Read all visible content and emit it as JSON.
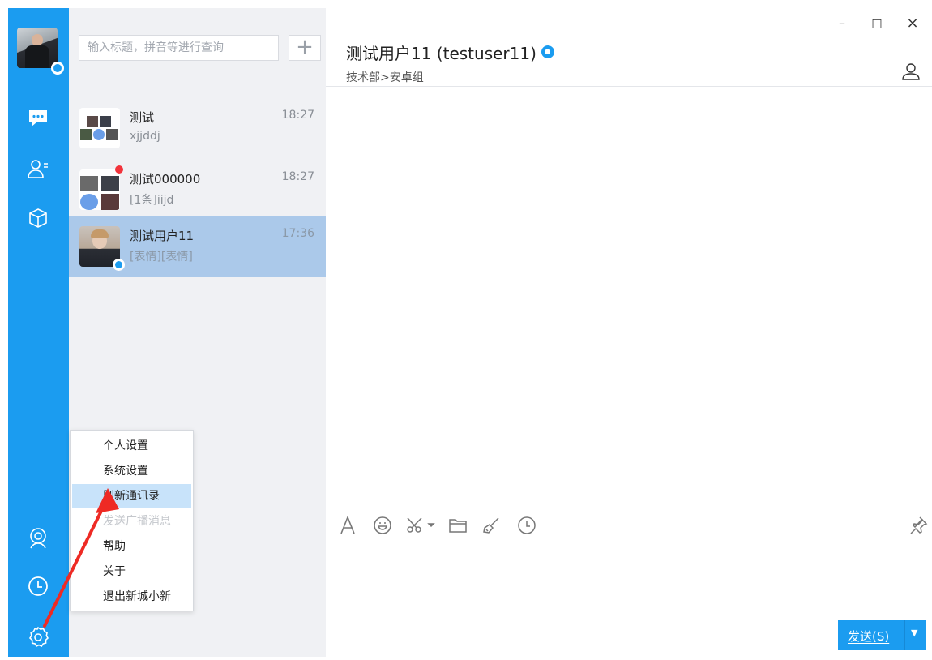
{
  "sidebar": {
    "icons": [
      "chat-bubble-icon",
      "contacts-icon",
      "apps-cube-icon",
      "camera-user-icon",
      "history-clock-icon",
      "settings-gear-icon"
    ]
  },
  "search": {
    "placeholder": "输入标题，拼音等进行查询",
    "add_label": "+"
  },
  "conversations": [
    {
      "name": "测试",
      "time": "18:27",
      "preview": "xjjddj"
    },
    {
      "name": "测试000000",
      "time": "18:27",
      "preview": "[1条]iijd"
    },
    {
      "name": "测试用户11",
      "time": "17:36",
      "preview": "[表情][表情]"
    }
  ],
  "chat": {
    "title": "测试用户11 (testuser11)",
    "subtitle": "技术部>安卓组",
    "window_controls": {
      "minimize": "–",
      "maximize": "□",
      "close": "×"
    },
    "send_label": "发送(S)",
    "send_dropdown": "▼"
  },
  "toolbar": {
    "icons": [
      "font-icon",
      "emoji-icon",
      "screenshot-scissors-icon",
      "folder-icon",
      "brush-icon",
      "clock-icon",
      "pin-icon"
    ]
  },
  "menu": {
    "items": [
      {
        "label": "个人设置"
      },
      {
        "label": "系统设置"
      },
      {
        "label": "刷新通讯录"
      },
      {
        "label": "发送广播消息"
      },
      {
        "label": "帮助"
      },
      {
        "label": "关于"
      },
      {
        "label": "退出新城小新"
      }
    ]
  },
  "colors": {
    "accent": "#1b9cf0",
    "selected_row": "#abc9ea",
    "annotation_arrow": "#ee2a24"
  }
}
